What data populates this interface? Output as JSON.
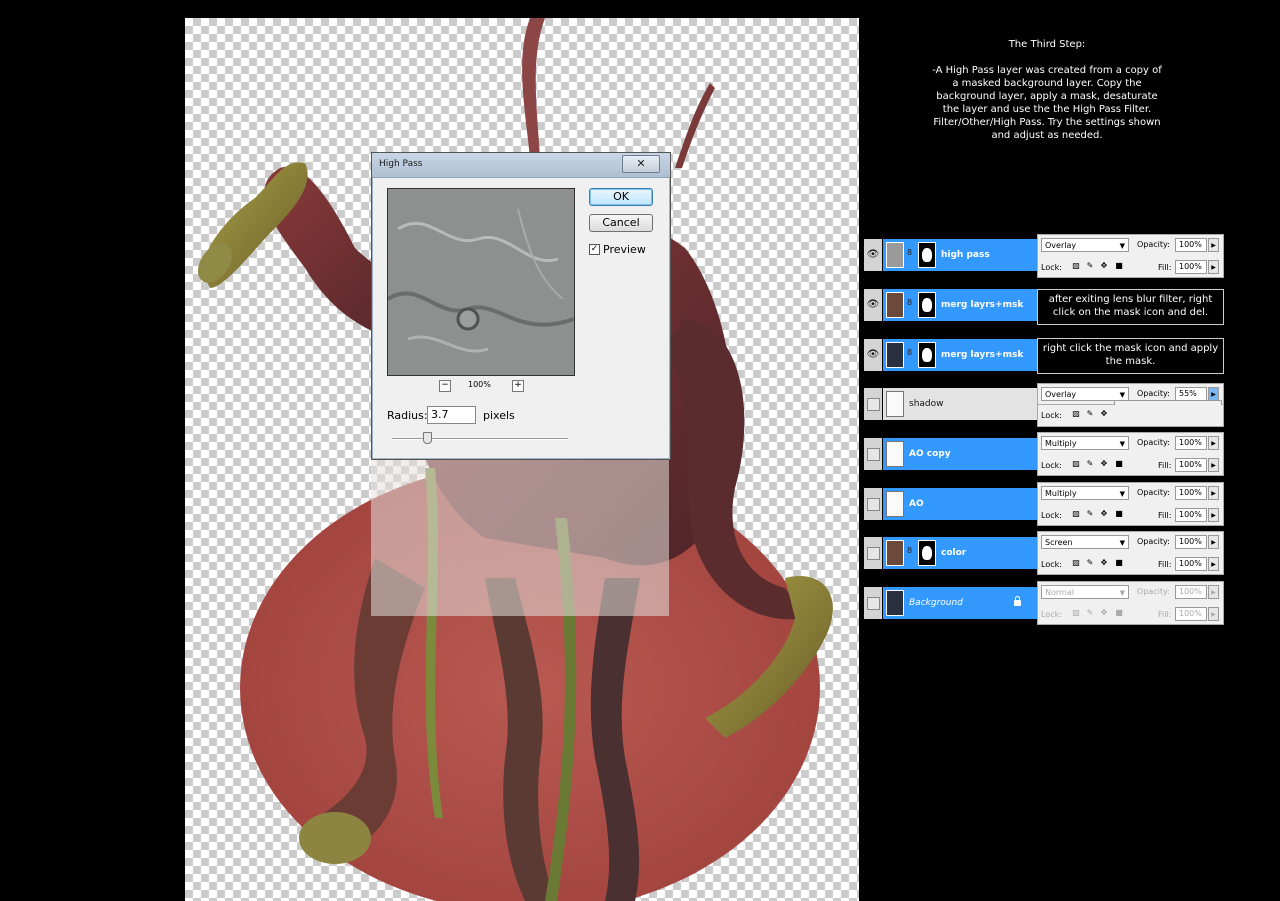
{
  "dialog": {
    "title": "High Pass",
    "close_glyph": "✕",
    "ok_label": "OK",
    "cancel_label": "Cancel",
    "preview_label": "Preview",
    "preview_checked": "✓",
    "zoom_out_glyph": "−",
    "zoom_in_glyph": "+",
    "zoom_level": "100%",
    "radius_label": "Radius:",
    "radius_value": "3.7",
    "radius_unit": "pixels"
  },
  "instructions": {
    "heading": "The Third Step:",
    "body": "-A High Pass layer was created from a copy of a masked background layer. Copy the background layer, apply a mask, desaturate the layer and use the the High Pass Filter. Filter/Other/High Pass. Try the settings shown and adjust as needed."
  },
  "layers_panel": {
    "opacity_label": "Opacity:",
    "lock_label": "Lock:",
    "fill_label": "Fill:",
    "opacity_slider_value": 0.55,
    "layers": [
      {
        "name": "high pass",
        "blend": "Overlay",
        "opacity": "100%",
        "fill": "100%"
      },
      {
        "name": "merg layrs+msk",
        "note": "after exiting lens blur filter, right click on the mask icon and del."
      },
      {
        "name": "merg layrs+msk",
        "note": "right click the mask icon and apply the mask."
      },
      {
        "name": "shadow",
        "blend": "Overlay",
        "opacity": "55%"
      },
      {
        "name": "AO copy",
        "blend": "Multiply",
        "opacity": "100%",
        "fill": "100%"
      },
      {
        "name": "AO",
        "blend": "Multiply",
        "opacity": "100%",
        "fill": "100%"
      },
      {
        "name": "color",
        "blend": "Screen",
        "opacity": "100%",
        "fill": "100%"
      },
      {
        "name": "Background",
        "blend": "Normal",
        "opacity": "100%",
        "fill": "100%"
      }
    ]
  },
  "colors": {
    "selected_layer": "#3399ff",
    "canvas_checker": "#cccccc",
    "background": "#000000"
  }
}
